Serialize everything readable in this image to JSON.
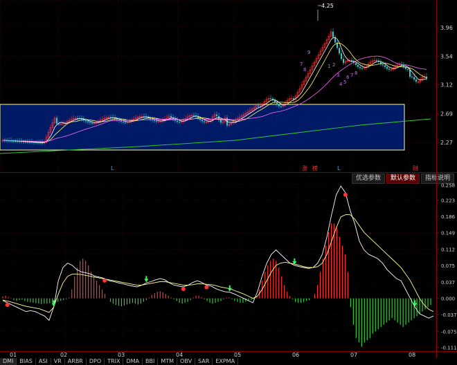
{
  "kline": {
    "price_ticks": [
      "3.96",
      "3.54",
      "3.12",
      "2.69",
      "2.27"
    ],
    "high_marker": "4.25",
    "markers": [
      {
        "label": "L",
        "color": "#33aaff"
      },
      {
        "label": "涨",
        "color": "#ff3333"
      },
      {
        "label": "榜",
        "color": "#ff3333"
      },
      {
        "label": "L",
        "color": "#33aaff"
      },
      {
        "label": "财",
        "color": "#ff3333"
      }
    ],
    "count_labels": [
      "7",
      "8",
      "9",
      "1",
      "2",
      "3",
      "4",
      "5",
      "6",
      "7",
      "8"
    ],
    "box_color": "#001a66"
  },
  "param_tabs": [
    {
      "label": "优选参数",
      "active": false
    },
    {
      "label": "默认参数",
      "active": true
    },
    {
      "label": "指标说明",
      "active": false
    }
  ],
  "chart_data": {
    "type": "bar",
    "x_labels": [
      "01",
      "02",
      "03",
      "04",
      "05",
      "06",
      "07",
      "08"
    ],
    "y_ticks": [
      "0.258",
      "0.223",
      "0.186",
      "0.149",
      "0.112",
      "0.075",
      "0.037",
      "0.000",
      "-0.037",
      "-0.075",
      "-0.111"
    ],
    "ylim": [
      -0.12,
      0.26
    ],
    "macd_bars": [
      0.004,
      0.006,
      0.003,
      0.001,
      -0.004,
      -0.006,
      -0.004,
      -0.003,
      -0.006,
      -0.008,
      -0.009,
      -0.01,
      -0.011,
      -0.012,
      -0.013,
      -0.012,
      -0.012,
      -0.011,
      -0.01,
      -0.009,
      -0.008,
      -0.006,
      -0.004,
      -0.002,
      0.002,
      0.02,
      0.05,
      0.07,
      0.085,
      0.09,
      0.085,
      0.075,
      0.06,
      0.05,
      0.04,
      0.03,
      0.02,
      0.01,
      0.0,
      -0.008,
      -0.012,
      -0.015,
      -0.017,
      -0.018,
      -0.016,
      -0.014,
      -0.012,
      -0.01,
      -0.012,
      -0.014,
      -0.012,
      -0.008,
      -0.004,
      0.002,
      0.008,
      0.012,
      0.015,
      0.016,
      0.014,
      0.01,
      0.006,
      0.002,
      -0.002,
      -0.006,
      -0.01,
      -0.012,
      -0.01,
      -0.008,
      -0.004,
      0.002,
      0.006,
      0.006,
      0.003,
      -0.002,
      -0.006,
      -0.01,
      -0.012,
      -0.01,
      -0.008,
      -0.006,
      -0.002,
      0.002,
      0.002,
      -0.002,
      -0.006,
      -0.008,
      -0.01,
      -0.01,
      -0.008,
      -0.006,
      -0.004,
      -0.002,
      0.004,
      0.02,
      0.04,
      0.06,
      0.075,
      0.085,
      0.09,
      0.085,
      0.07,
      0.05,
      0.03,
      0.015,
      0.005,
      -0.002,
      -0.008,
      -0.01,
      -0.01,
      -0.008,
      -0.006,
      -0.004,
      0.0,
      0.01,
      0.03,
      0.06,
      0.09,
      0.12,
      0.15,
      0.17,
      0.17,
      0.16,
      0.14,
      0.12,
      0.1,
      0.06,
      -0.02,
      -0.06,
      -0.09,
      -0.1,
      -0.11,
      -0.1,
      -0.095,
      -0.09,
      -0.08,
      -0.075,
      -0.07,
      -0.065,
      -0.06,
      -0.055,
      -0.05,
      -0.045,
      -0.05,
      -0.055,
      -0.06,
      -0.065,
      -0.06,
      -0.055,
      -0.05,
      -0.045,
      -0.04,
      -0.035,
      -0.03,
      -0.025,
      -0.02,
      -0.015
    ],
    "dif": [
      -0.005,
      -0.01,
      -0.015,
      -0.02,
      -0.025,
      -0.03,
      -0.028,
      -0.03,
      -0.035,
      -0.04,
      -0.05,
      -0.02,
      0.04,
      0.07,
      0.08,
      0.075,
      0.065,
      0.06,
      0.058,
      0.055,
      0.05,
      0.048,
      0.045,
      0.04,
      0.038,
      0.035,
      0.033,
      0.03,
      0.028,
      0.026,
      0.03,
      0.035,
      0.038,
      0.042,
      0.045,
      0.042,
      0.035,
      0.03,
      0.028,
      0.026,
      0.03,
      0.036,
      0.04,
      0.036,
      0.03,
      0.028,
      0.022,
      0.018,
      0.015,
      0.014,
      0.01,
      0.005,
      0.0,
      -0.005,
      -0.01,
      0.015,
      0.05,
      0.08,
      0.1,
      0.11,
      0.1,
      0.09,
      0.08,
      0.075,
      0.072,
      0.07,
      0.068,
      0.07,
      0.08,
      0.1,
      0.14,
      0.19,
      0.235,
      0.255,
      0.24,
      0.2,
      0.17,
      0.13,
      0.11,
      0.1,
      0.095,
      0.09,
      0.08,
      0.065,
      0.055,
      0.045,
      0.04,
      0.02,
      0.0,
      -0.02,
      -0.035,
      -0.04,
      -0.045,
      -0.04
    ],
    "dea": [
      -0.004,
      -0.006,
      -0.009,
      -0.012,
      -0.015,
      -0.018,
      -0.02,
      -0.022,
      -0.024,
      -0.028,
      -0.032,
      -0.02,
      0.01,
      0.035,
      0.05,
      0.055,
      0.055,
      0.054,
      0.052,
      0.05,
      0.048,
      0.046,
      0.044,
      0.042,
      0.04,
      0.038,
      0.036,
      0.034,
      0.032,
      0.03,
      0.03,
      0.032,
      0.034,
      0.036,
      0.038,
      0.038,
      0.036,
      0.034,
      0.032,
      0.03,
      0.03,
      0.031,
      0.033,
      0.033,
      0.032,
      0.031,
      0.029,
      0.026,
      0.024,
      0.022,
      0.018,
      0.014,
      0.01,
      0.005,
      0.0,
      0.005,
      0.02,
      0.04,
      0.06,
      0.075,
      0.08,
      0.082,
      0.08,
      0.078,
      0.075,
      0.072,
      0.07,
      0.07,
      0.072,
      0.08,
      0.1,
      0.13,
      0.16,
      0.185,
      0.19,
      0.19,
      0.18,
      0.165,
      0.15,
      0.14,
      0.13,
      0.12,
      0.11,
      0.1,
      0.09,
      0.08,
      0.07,
      0.055,
      0.04,
      0.02,
      0.0,
      -0.015,
      -0.025,
      -0.03
    ],
    "buy_signals": [
      11,
      31,
      49,
      63,
      89
    ],
    "sell_signals": [
      1,
      22,
      39,
      44,
      74,
      101
    ]
  },
  "bottom_tabs": [
    "DMI",
    "BIAS",
    "ASI",
    "VR",
    "ARBR",
    "DPO",
    "TRIX",
    "DMA",
    "BBI",
    "MTM",
    "OBV",
    "SAR",
    "EXPMA"
  ],
  "colors": {
    "up": "#ff3333",
    "down": "#33cccc",
    "ma5": "#ffffff",
    "ma10": "#ffff66",
    "ma20": "#ff66ff",
    "ma60": "#33cc33",
    "grid": "#3a0000",
    "axis": "#8b0000"
  }
}
